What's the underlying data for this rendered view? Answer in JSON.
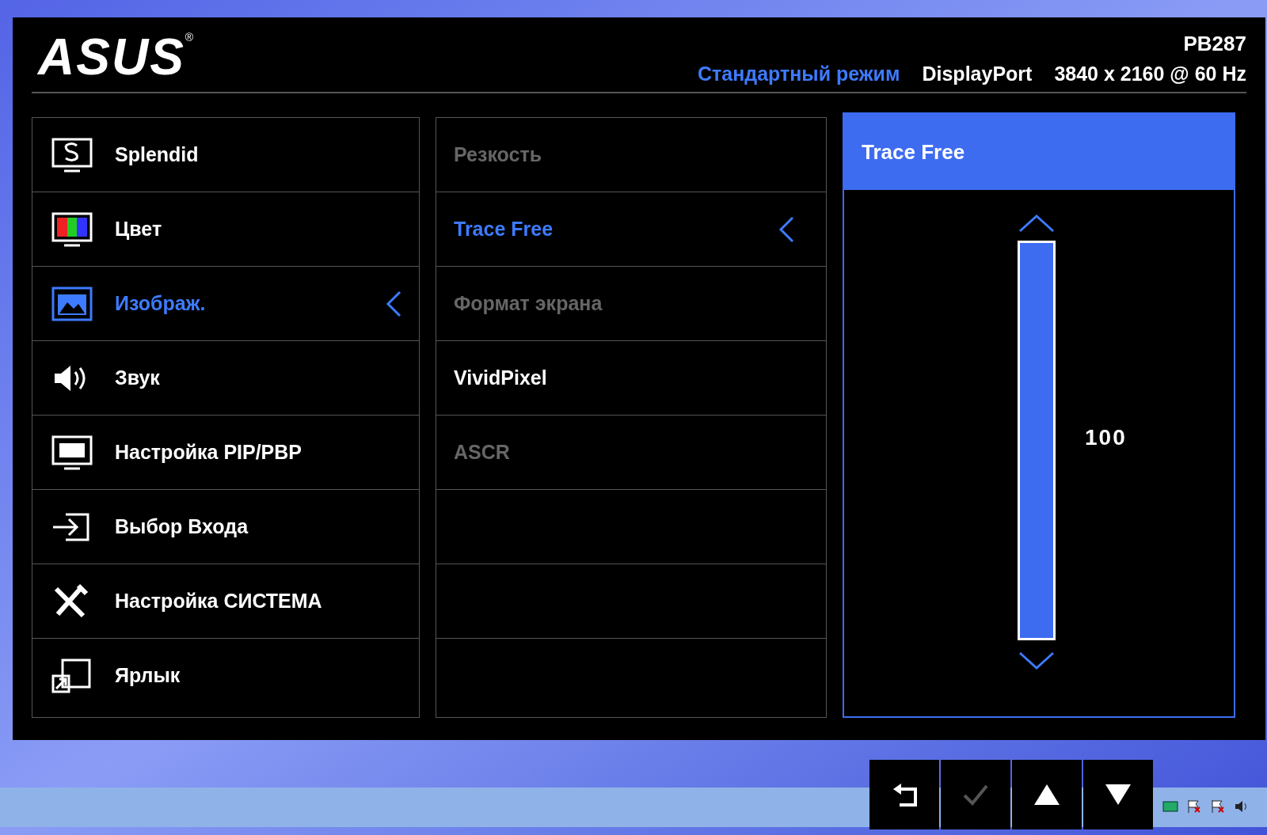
{
  "header": {
    "logo": "ASUS",
    "logo_mark": "®",
    "model": "PB287",
    "mode": "Стандартный режим",
    "input": "DisplayPort",
    "resolution": "3840 x 2160 @ 60 Hz"
  },
  "main_menu": [
    {
      "kind": "splendid",
      "label": "Splendid",
      "selected": false
    },
    {
      "kind": "color",
      "label": "Цвет",
      "selected": false
    },
    {
      "kind": "image",
      "label": "Изображ.",
      "selected": true
    },
    {
      "kind": "sound",
      "label": "Звук",
      "selected": false
    },
    {
      "kind": "pip",
      "label": "Настройка PIP/PBP",
      "selected": false
    },
    {
      "kind": "input",
      "label": "Выбор Входа",
      "selected": false
    },
    {
      "kind": "system",
      "label": "Настройка СИСТЕМА",
      "selected": false
    },
    {
      "kind": "shortcut",
      "label": "Ярлык",
      "selected": false
    }
  ],
  "sub_menu": [
    {
      "label": "Резкость",
      "selected": false,
      "disabled": true
    },
    {
      "label": "Trace Free",
      "selected": true,
      "disabled": false
    },
    {
      "label": "Формат экрана",
      "selected": false,
      "disabled": true
    },
    {
      "label": "VividPixel",
      "selected": false,
      "disabled": false
    },
    {
      "label": "ASCR",
      "selected": false,
      "disabled": true
    }
  ],
  "setting": {
    "title": "Trace Free",
    "level": 1.0,
    "value": "100"
  },
  "nav_buttons": [
    {
      "kind": "back",
      "disabled": false
    },
    {
      "kind": "confirm",
      "disabled": true
    },
    {
      "kind": "up",
      "disabled": false
    },
    {
      "kind": "down",
      "disabled": false
    }
  ]
}
